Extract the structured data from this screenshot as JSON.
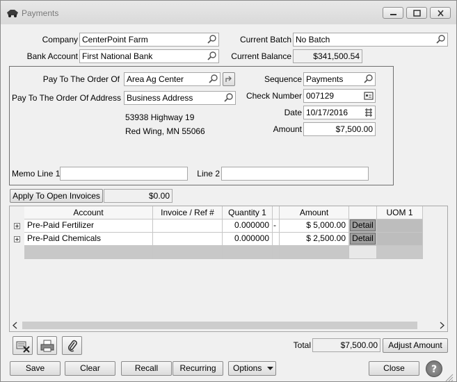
{
  "window": {
    "title": "Payments"
  },
  "header": {
    "company_label": "Company",
    "company_value": "CenterPoint Farm",
    "bank_label": "Bank Account",
    "bank_value": "First National Bank",
    "batch_label": "Current Batch",
    "batch_value": "No Batch",
    "balance_label": "Current Balance",
    "balance_value": "$341,500.54"
  },
  "payee": {
    "order_label": "Pay To The Order Of",
    "order_value": "Area Ag Center",
    "address_label": "Pay To The Order Of Address",
    "address_value": "Business Address",
    "address_line1": "53938 Highway 19",
    "address_line2": "Red Wing, MN  55066",
    "sequence_label": "Sequence",
    "sequence_value": "Payments",
    "check_label": "Check Number",
    "check_value": "007129",
    "date_label": "Date",
    "date_value": "10/17/2016",
    "amount_label": "Amount",
    "amount_value": "$7,500.00",
    "memo1_label": "Memo Line 1",
    "memo1_value": "",
    "memo2_label": "Line 2",
    "memo2_value": ""
  },
  "apply": {
    "button_label": "Apply To Open Invoices",
    "value": "$0.00"
  },
  "grid": {
    "columns": [
      "Account",
      "Invoice / Ref #",
      "Quantity 1",
      "Amount",
      "UOM 1"
    ],
    "rows": [
      {
        "account": "Pre-Paid Fertilizer",
        "invoice": "",
        "quantity": "0.000000",
        "flag": "-",
        "amount": "$ 5,000.00",
        "detail": "Detail",
        "uom": ""
      },
      {
        "account": "Pre-Paid Chemicals",
        "invoice": "",
        "quantity": "0.000000",
        "flag": "",
        "amount": "$ 2,500.00",
        "detail": "Detail",
        "uom": ""
      }
    ]
  },
  "footer": {
    "total_label": "Total",
    "total_value": "$7,500.00",
    "adjust_label": "Adjust Amount",
    "buttons": {
      "save": "Save",
      "clear": "Clear",
      "recall": "Recall",
      "recurring": "Recurring",
      "options": "Options",
      "close": "Close"
    }
  },
  "icons": {
    "app": "truck-icon",
    "lookup": "magnifier-icon",
    "calendar": "calendar-icon",
    "help": "help-icon"
  }
}
